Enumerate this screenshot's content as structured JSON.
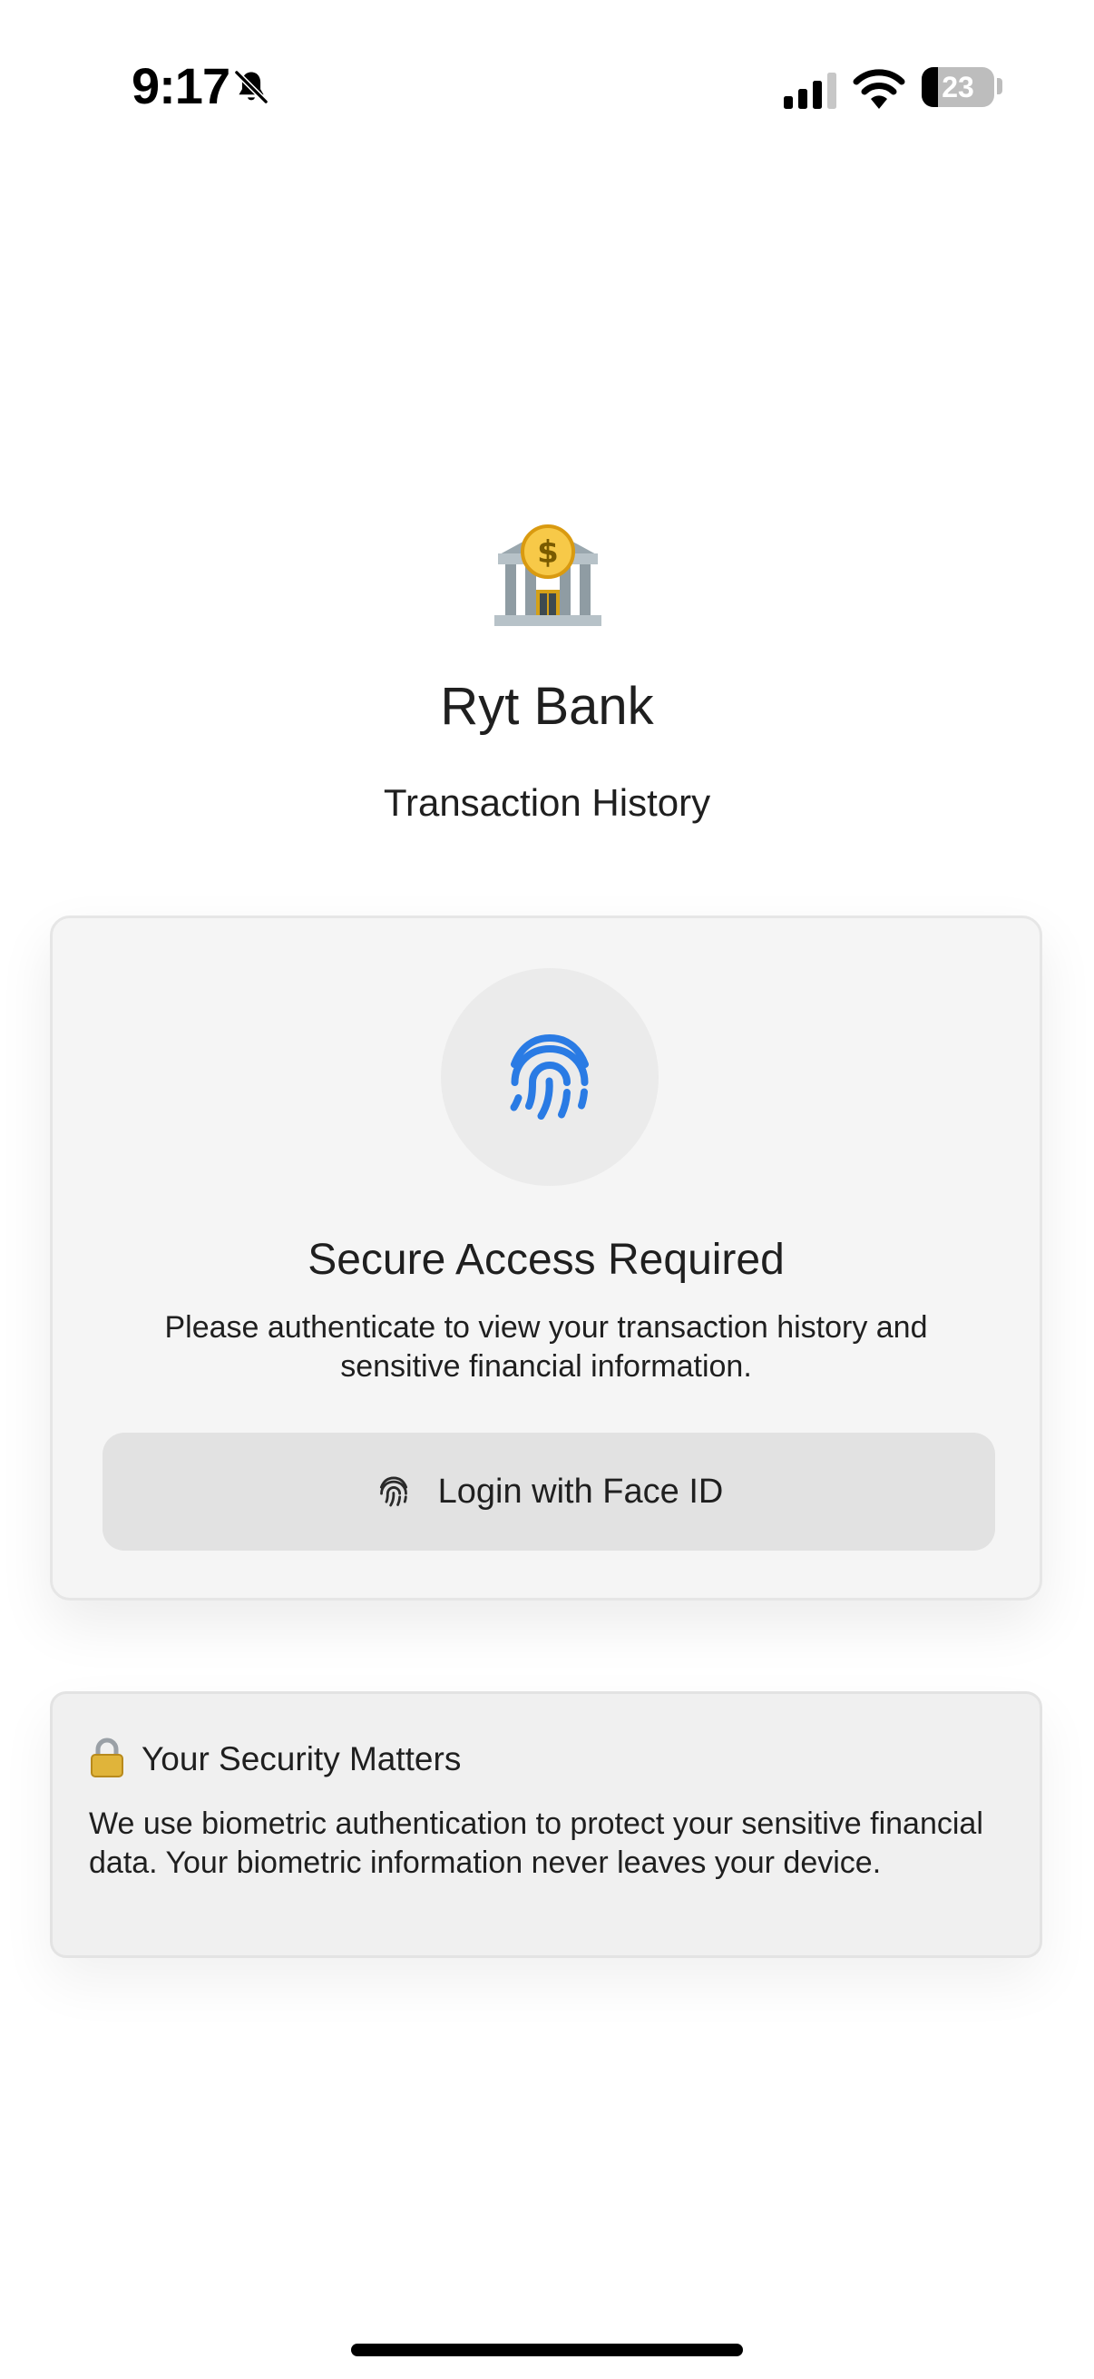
{
  "status_bar": {
    "time": "9:17",
    "battery_text": "23",
    "battery_level": 0.23,
    "icons": [
      "bell-slash-icon",
      "cellular-signal-icon",
      "wifi-icon",
      "battery-icon"
    ]
  },
  "header": {
    "icon": "bank-icon",
    "title": "Ryt Bank",
    "subtitle": "Transaction History"
  },
  "auth_card": {
    "icon": "fingerprint-icon",
    "title": "Secure Access Required",
    "description": "Please authenticate to view your transaction history and sensitive financial information.",
    "button_icon": "fingerprint-icon",
    "button_label": "Login with Face ID"
  },
  "security_card": {
    "icon": "lock-icon",
    "title": "Your Security Matters",
    "text": "We use biometric authentication to protect your sensitive financial data. Your biometric information never leaves your device."
  },
  "colors": {
    "accent": "#2a7be4",
    "card_background": "#f5f5f5",
    "button_background": "#e2e2e2",
    "text": "#1f1f1f"
  }
}
